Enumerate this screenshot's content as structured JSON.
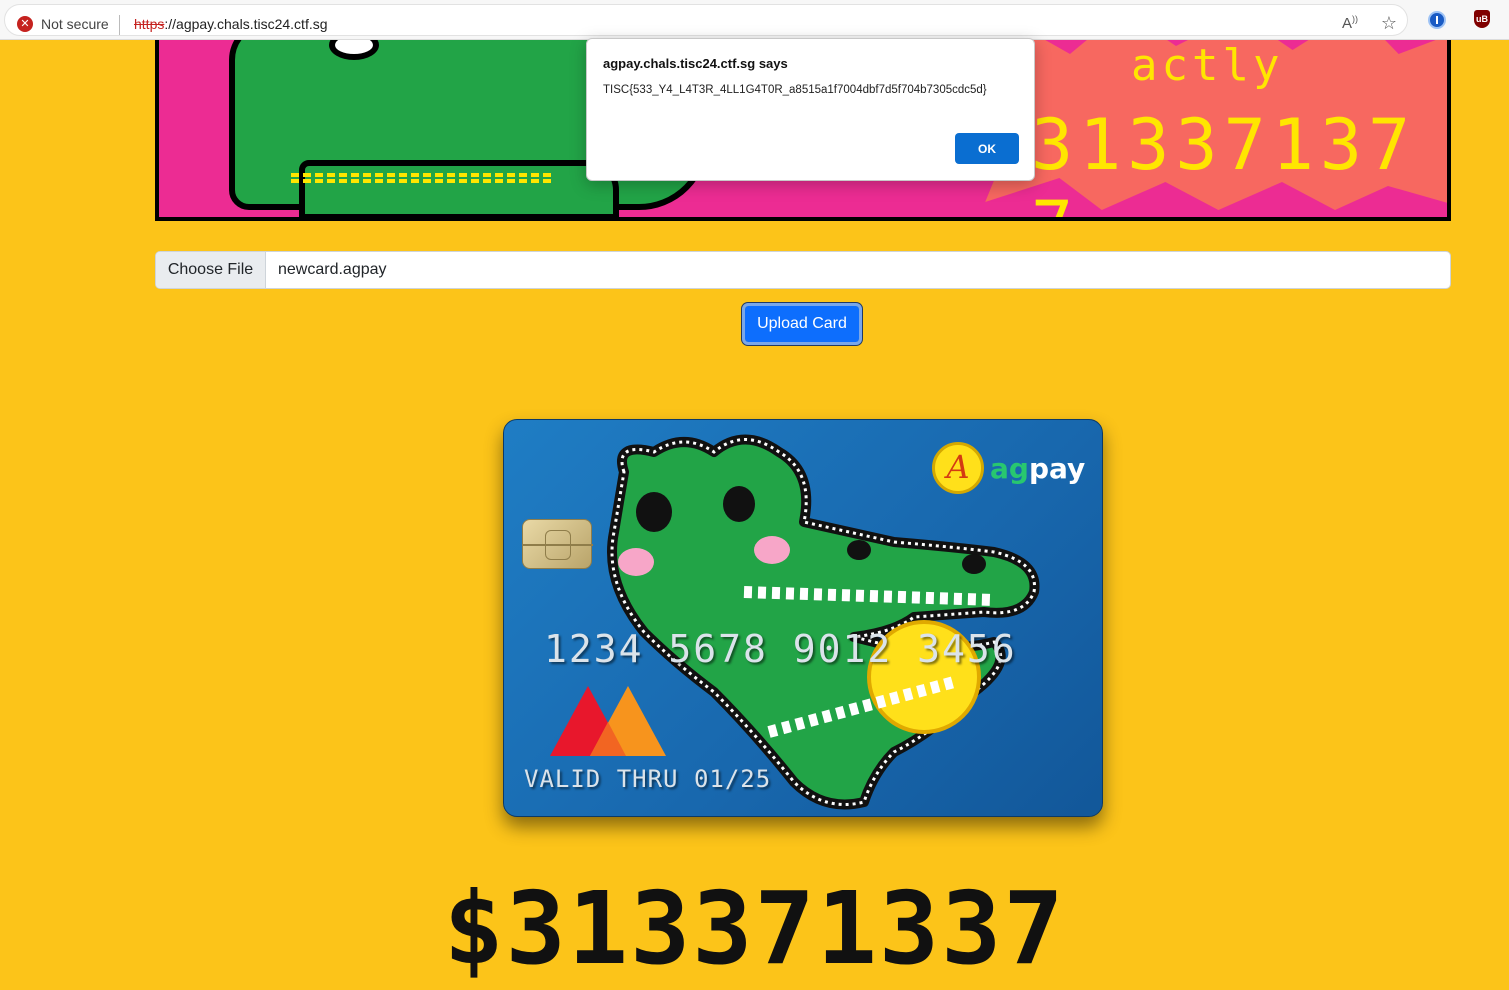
{
  "browser": {
    "security_label": "Not secure",
    "url_scheme": "https",
    "url_rest": "://agpay.chals.tisc24.ctf.sg",
    "icons": [
      "not-secure-icon",
      "read-aloud-icon",
      "favorite-star-icon",
      "password-manager-icon",
      "ublock-icon"
    ]
  },
  "banner": {
    "text_line1": "actly",
    "text_line2": "31337137 7"
  },
  "dialog": {
    "title": "agpay.chals.tisc24.ctf.sg says",
    "message": "TISC{533_Y4_L4T3R_4LL1G4T0R_a8515a1f7004dbf7d5f704b7305cdc5d}",
    "ok_label": "OK"
  },
  "upload": {
    "choose_label": "Choose File",
    "file_name": "newcard.agpay",
    "button_label": "Upload Card"
  },
  "card": {
    "brand_prefix": "ag",
    "brand_suffix": "pay",
    "logo_letter": "A",
    "number": "1234 5678 9012 3456",
    "valid_thru": "VALID THRU 01/25"
  },
  "balance": "$313371337",
  "colors": {
    "page_bg": "#fcc419",
    "banner_bg": "#ec2c93",
    "card_bg": "#1f7dc4",
    "primary_button": "#0d6efd",
    "dialog_ok": "#0a6ed1"
  }
}
